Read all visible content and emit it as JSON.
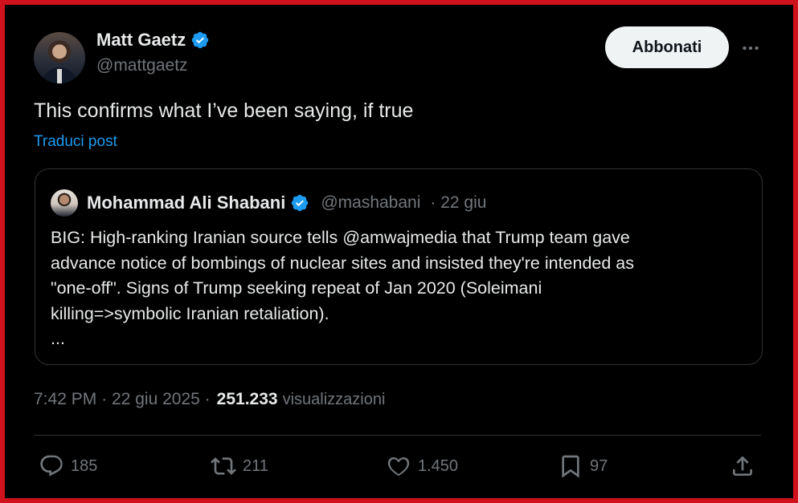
{
  "author": {
    "name": "Matt Gaetz",
    "handle": "@mattgaetz",
    "verified": true
  },
  "follow_label": "Abbonati",
  "post_text": "This confirms what I’ve been saying, if true",
  "translate_label": "Traduci post",
  "quoted": {
    "name": "Mohammad Ali Shabani",
    "handle": "@mashabani",
    "date": "· 22 giu",
    "lines": [
      "BIG: High-ranking Iranian source tells @amwajmedia that Trump team gave",
      "advance notice of bombings of nuclear sites and insisted they're intended as",
      "\"one-off\". Signs of Trump seeking repeat of Jan 2020 (Soleimani",
      "killing=>symbolic Iranian retaliation).",
      "..."
    ]
  },
  "meta": {
    "time": "7:42 PM",
    "date": "· 22 giu 2025 ·",
    "views": "251.233",
    "views_label": "visualizzazioni"
  },
  "actions": {
    "replies": "185",
    "reposts": "211",
    "likes": "1.450",
    "bookmarks": "97"
  },
  "colors": {
    "background": "#000000",
    "border": "#d0121c",
    "verified": "#1d9bf0",
    "link": "#1d9bf0",
    "muted": "#71767b"
  },
  "icons": [
    "verified-badge-icon",
    "more-icon",
    "reply-icon",
    "repost-icon",
    "like-icon",
    "bookmark-icon",
    "share-icon"
  ]
}
